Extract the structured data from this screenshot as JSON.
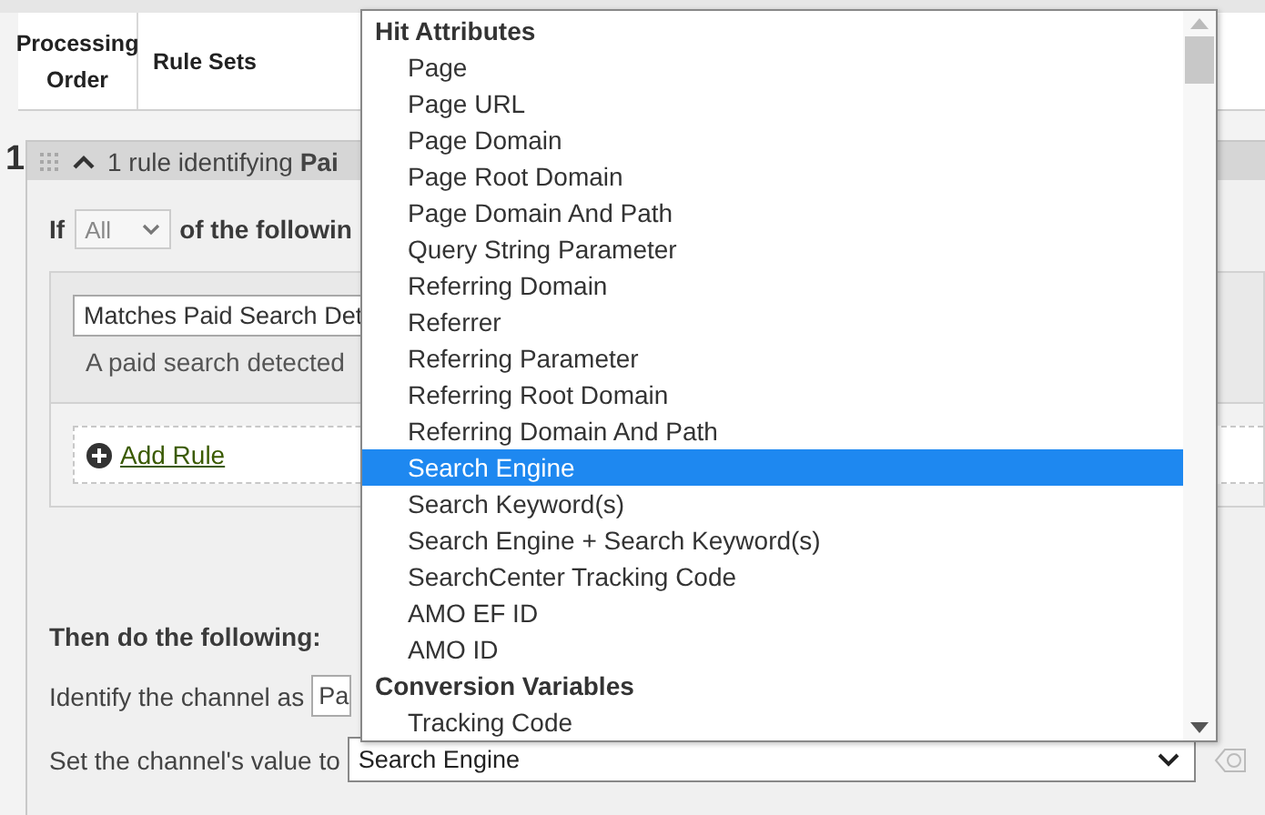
{
  "table_header": {
    "columns": [
      "Processing Order",
      "Rule Sets"
    ]
  },
  "rule_set": {
    "order": "1",
    "title": "1 rule identifying **Pai**",
    "expanded": true,
    "match": {
      "prefix": "If",
      "mode": "All",
      "suffix": "of the followin"
    },
    "rules": [
      {
        "value": "Matches Paid Search Det",
        "description": "A paid search detected"
      }
    ],
    "add_rule": "Add Rule",
    "actions_title": "Then do the following:",
    "identify": {
      "label": "Identify the channel as",
      "value": "Pa"
    },
    "set_value": {
      "label": "Set the channel's value to",
      "value": "Search Engine"
    }
  },
  "dropdown": {
    "groups": [
      {
        "label": "Hit Attributes",
        "options": [
          {
            "label": "Page",
            "selected": false
          },
          {
            "label": "Page URL",
            "selected": false
          },
          {
            "label": "Page Domain",
            "selected": false
          },
          {
            "label": "Page Root Domain",
            "selected": false
          },
          {
            "label": "Page Domain And Path",
            "selected": false
          },
          {
            "label": "Query String Parameter",
            "selected": false
          },
          {
            "label": "Referring Domain",
            "selected": false
          },
          {
            "label": "Referrer",
            "selected": false
          },
          {
            "label": "Referring Parameter",
            "selected": false
          },
          {
            "label": "Referring Root Domain",
            "selected": false
          },
          {
            "label": "Referring Domain And Path",
            "selected": false
          },
          {
            "label": "Search Engine",
            "selected": true
          },
          {
            "label": "Search Keyword(s)",
            "selected": false
          },
          {
            "label": "Search Engine + Search Keyword(s)",
            "selected": false
          },
          {
            "label": "SearchCenter Tracking Code",
            "selected": false
          },
          {
            "label": "AMO EF ID",
            "selected": false
          },
          {
            "label": "AMO ID",
            "selected": false
          }
        ]
      },
      {
        "label": "Conversion Variables",
        "options": [
          {
            "label": "Tracking Code",
            "selected": false
          }
        ]
      }
    ]
  }
}
